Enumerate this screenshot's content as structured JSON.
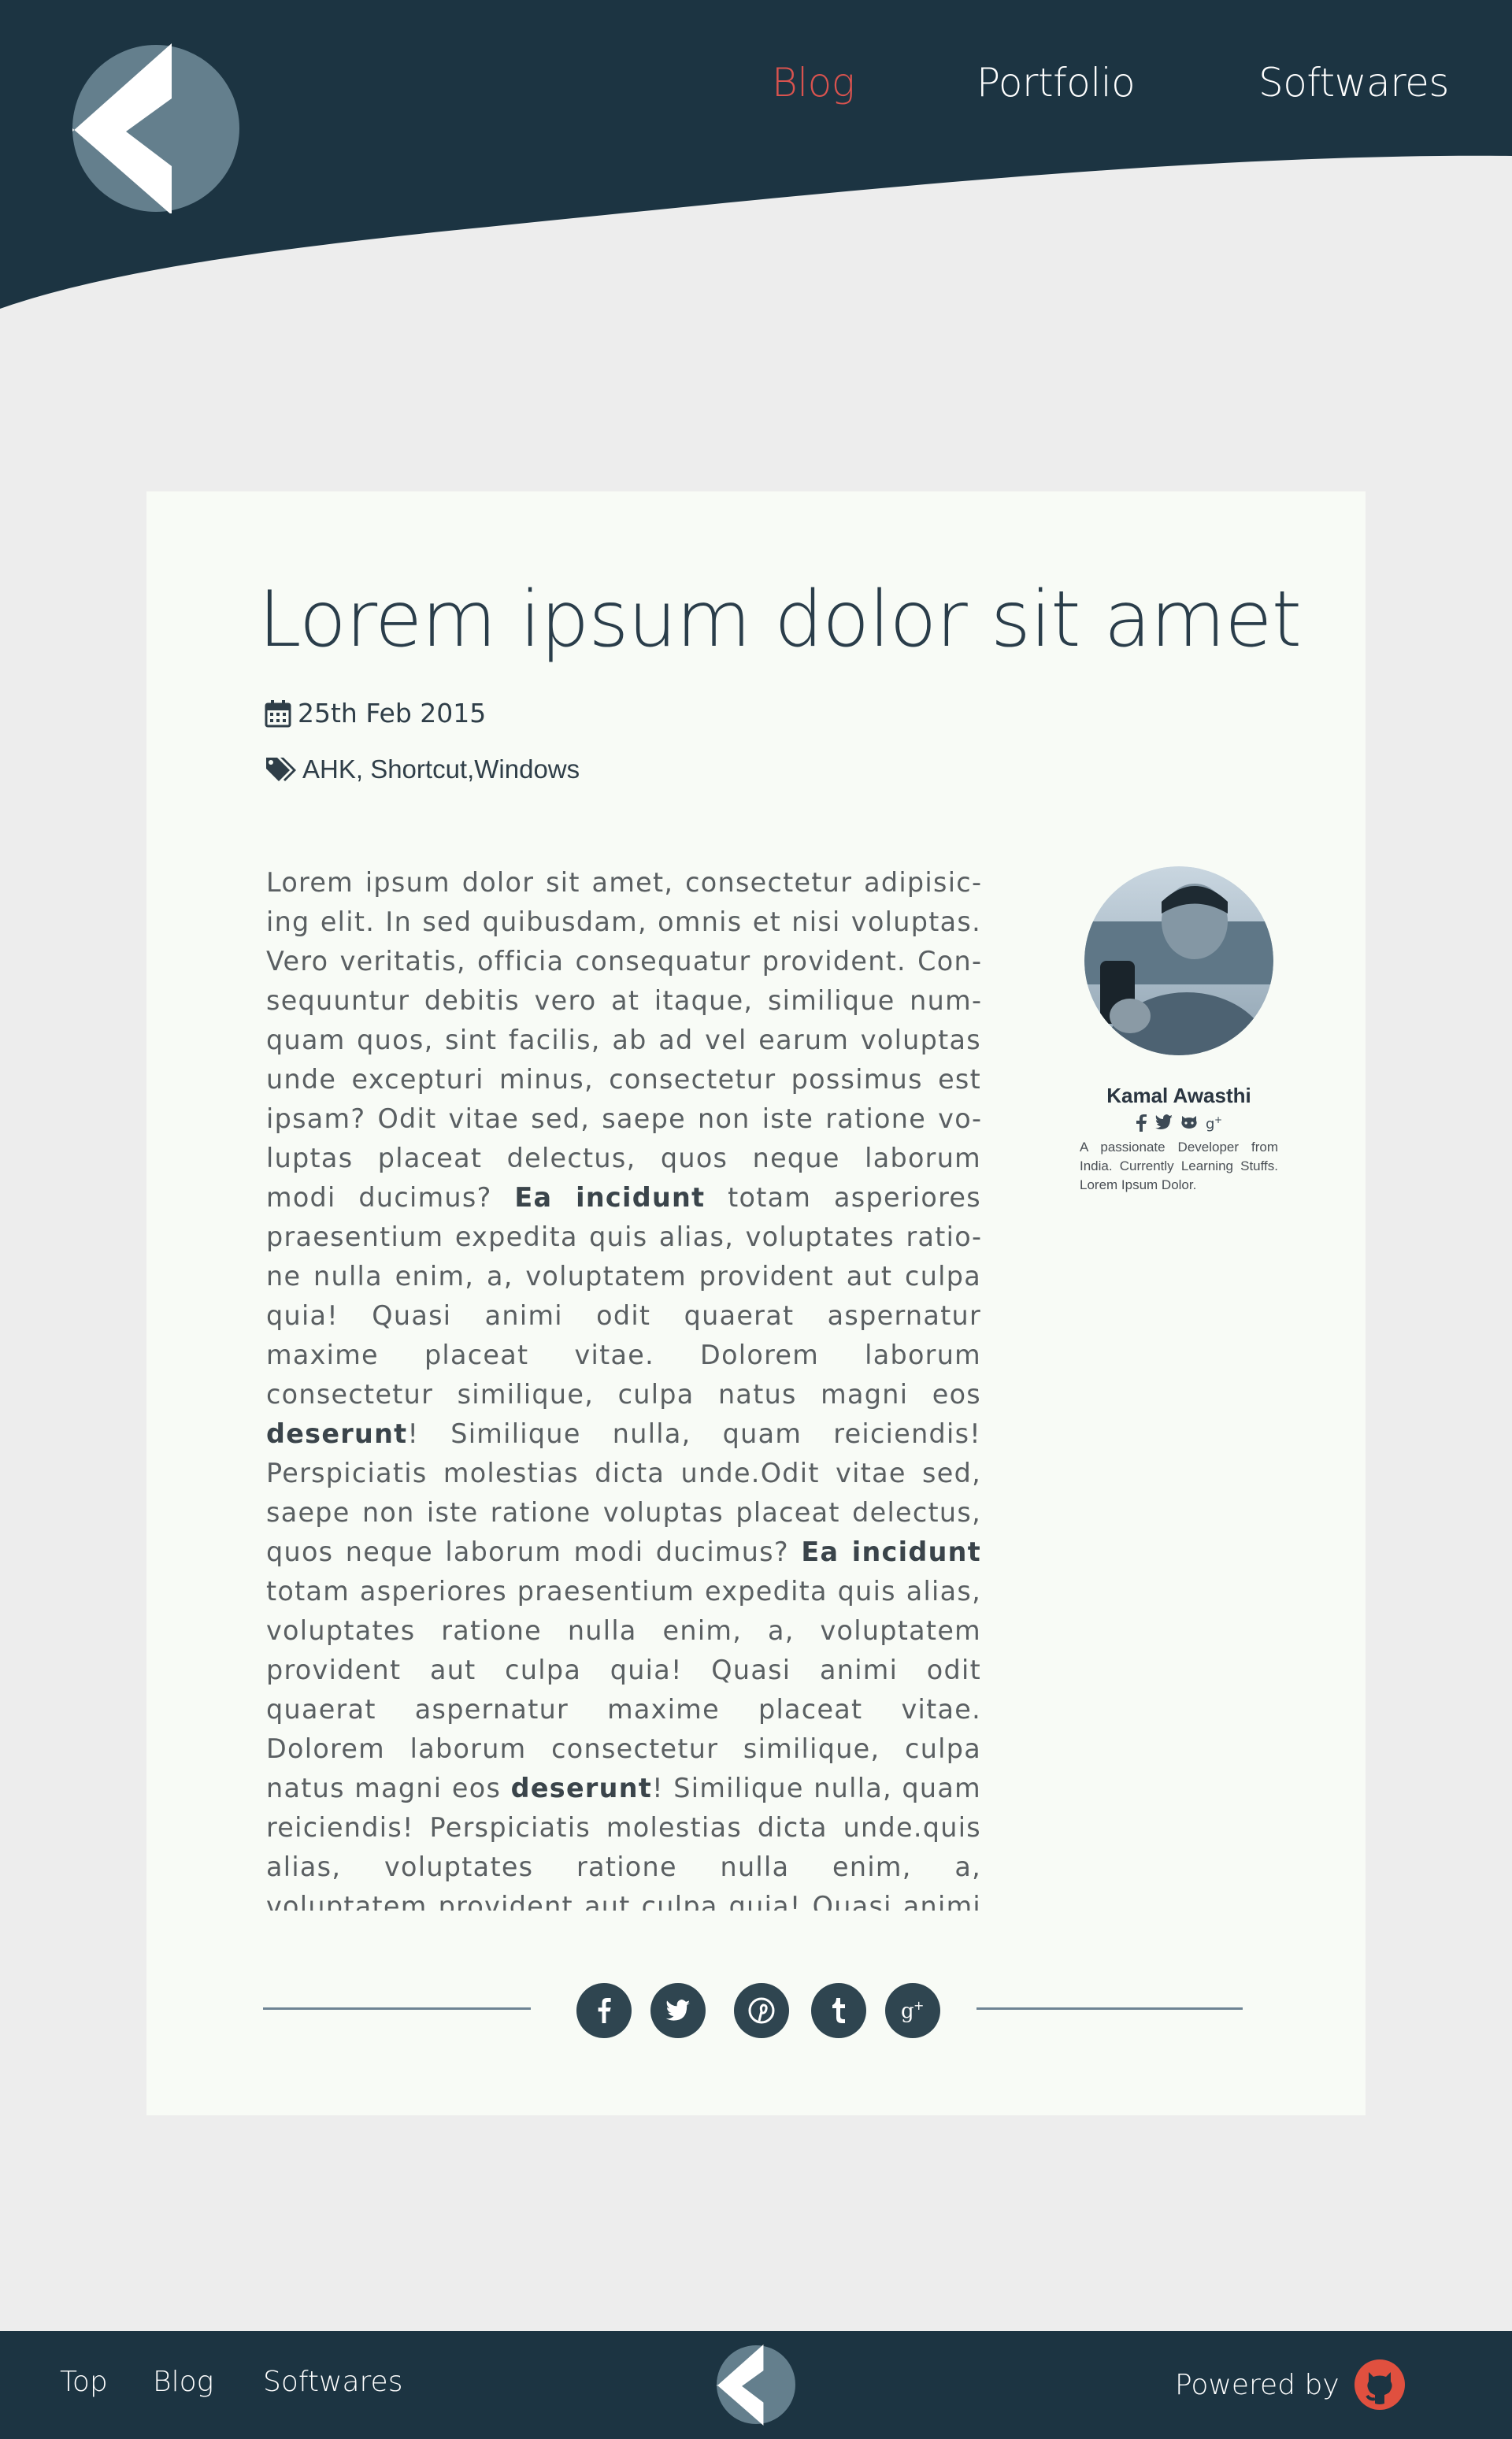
{
  "header": {
    "nav": [
      {
        "label": "Blog",
        "active": true
      },
      {
        "label": "Portfolio",
        "active": false
      },
      {
        "label": "Softwares",
        "active": false
      }
    ],
    "logo_icon": "k-chevron-logo-icon"
  },
  "post": {
    "title": "Lorem ipsum dolor sit amet",
    "date": "25th Feb 2015",
    "tags": "AHK, Shortcut,Windows",
    "body_html": "Lorem ipsum dolor sit amet, consectetur adipisic­ing elit. In sed quibusdam, omnis et nisi voluptas. Vero veritatis, officia consequatur provident. Con­sequuntur debitis vero at itaque, similique num­quam quos, sint facilis, ab ad vel earum voluptas unde excepturi minus, consectetur possimus est ipsam? Odit vitae sed, saepe non iste ratione vo­luptas placeat delectus, quos neque laborum modi ducimus? <b>Ea incidunt</b> totam asperiores praesentium expedita quis alias, voluptates ratio­ne nulla enim, a, voluptatem provident aut culpa quia! Quasi animi odit quaerat aspernatur maxime placeat vitae. Dolorem laborum consectetur simi­lique, culpa natus magni eos <b>deserunt</b>! Similique nulla, quam reiciendis! Perspiciatis molestias dicta unde.Odit vitae sed, saepe non iste ratione volup­tas placeat delectus, quos neque laborum modi ducimus? <b>Ea incidunt</b> totam asperiores praesenti­um expedita quis alias, voluptates ratione nulla enim, a, voluptatem provident aut culpa quia! Quasi animi odit quaerat aspernatur maxime placeat vitae. Dolorem laborum consectetur simi­lique, culpa natus magni eos <b>deserunt</b>! Similique nulla, quam reiciendis! Perspiciatis molestias dicta unde.quis alias, voluptates ratione nulla enim, a, voluptatem provident aut culpa quia! Quasi animi odit quaerat aspernatur maxime placeat vitae. Do­"
  },
  "author": {
    "name": "Kamal Awasthi",
    "bio": "A passionate Developer from India. Currently Learning Stuffs. Lorem Ipsum Dolor.",
    "socials": [
      "facebook-icon",
      "twitter-icon",
      "github-icon",
      "google-plus-icon"
    ]
  },
  "share": {
    "buttons": [
      "facebook-icon",
      "twitter-icon",
      "pinterest-icon",
      "tumblr-icon",
      "google-plus-icon"
    ]
  },
  "footer": {
    "links": [
      "Top",
      "Blog",
      "Softwares"
    ],
    "powered_by": "Powered by"
  },
  "colors": {
    "header_bg": "#1c3442",
    "accent": "#d9534f",
    "card_bg": "#f8fbf6",
    "page_bg": "#ededed"
  }
}
